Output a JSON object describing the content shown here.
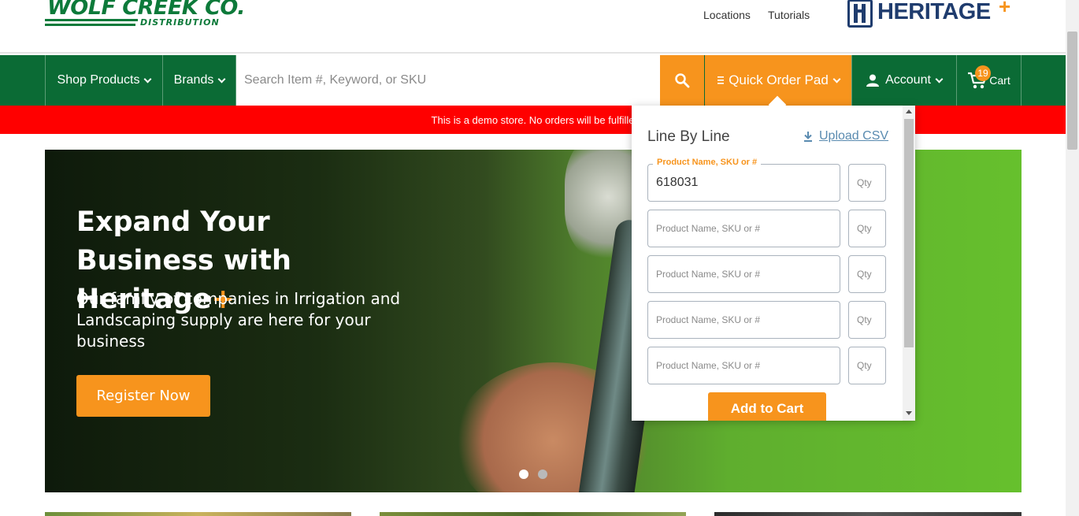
{
  "header": {
    "logo_name": "WOLF CREEK CO.",
    "logo_sub": "DISTRIBUTION",
    "links": [
      "Locations",
      "Tutorials"
    ],
    "brand_logo": "HERITAGE",
    "brand_plus": "+"
  },
  "nav": {
    "shop_products": "Shop Products",
    "brands": "Brands",
    "search_placeholder": "Search Item #, Keyword, or SKU",
    "search_icon": "search-icon",
    "quick_order_pad": "Quick Order Pad",
    "account": "Account",
    "cart_label": "Cart",
    "cart_count": "19"
  },
  "demo_notice": "This is a demo store. No orders will be fulfille",
  "hero": {
    "title": "Expand Your Business with Heritage",
    "title_plus": "+",
    "subtitle": "Our family of companies in Irrigation and Landscaping supply are here for your business",
    "button": "Register Now",
    "slides": 2,
    "active_slide": 1
  },
  "quick_order": {
    "title": "Line By Line",
    "upload_label": "Upload CSV",
    "field_label": "Product Name, SKU or #",
    "qty_placeholder": "Qty",
    "rows": [
      {
        "value": "618031"
      },
      {
        "value": ""
      },
      {
        "value": ""
      },
      {
        "value": ""
      },
      {
        "value": ""
      }
    ],
    "add_to_cart": "Add to Cart"
  },
  "colors": {
    "green": "#0b6b35",
    "orange": "#f7941d",
    "red": "#ff0000",
    "heritage_blue": "#1f3c6e"
  }
}
